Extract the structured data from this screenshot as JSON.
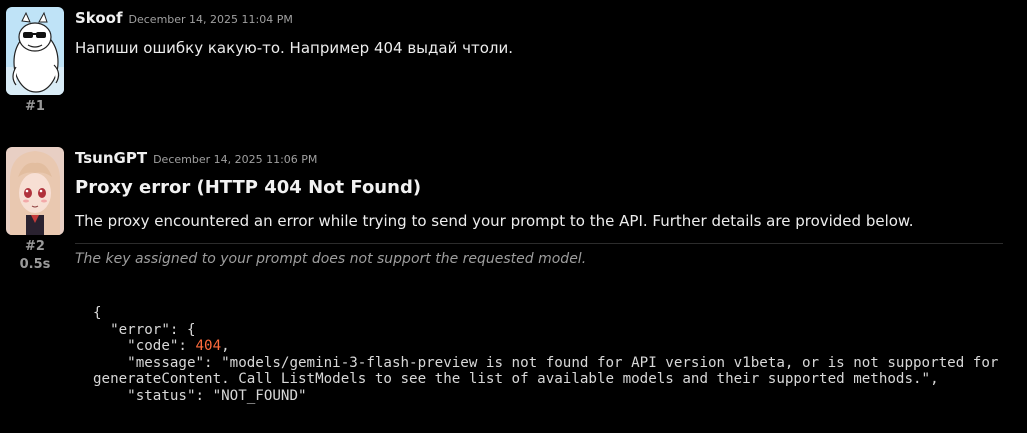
{
  "colors": {
    "background": "#000000",
    "number_accent": "#ff6b3d"
  },
  "messages": [
    {
      "author": "Skoof",
      "timestamp": "December 14, 2025 11:04 PM",
      "index": "#1",
      "avatar_icon": "cartoon-character-sunglasses-avatar",
      "text": "Напиши ошибку какую-то. Например 404 выдай чтоли."
    },
    {
      "author": "TsunGPT",
      "timestamp": "December 14, 2025 11:06 PM",
      "index": "#2",
      "time_taken": "0.5s",
      "avatar_icon": "anime-girl-avatar",
      "title": "Proxy error (HTTP 404 Not Found)",
      "description": "The proxy encountered an error while trying to send your prompt to the API. Further details are provided below.",
      "note": "The key assigned to your prompt does not support the requested model.",
      "code": {
        "line1": "{",
        "line2": "  \"error\": {",
        "code_key": "    \"code\": ",
        "code_value": "404",
        "code_tail": ",",
        "message_line": "    \"message\": \"models/gemini-3-flash-preview is not found for API version v1beta, or is not supported for generateContent. Call ListModels to see the list of available models and their supported methods.\",",
        "status_line": "    \"status\": \"NOT_FOUND\""
      }
    }
  ]
}
